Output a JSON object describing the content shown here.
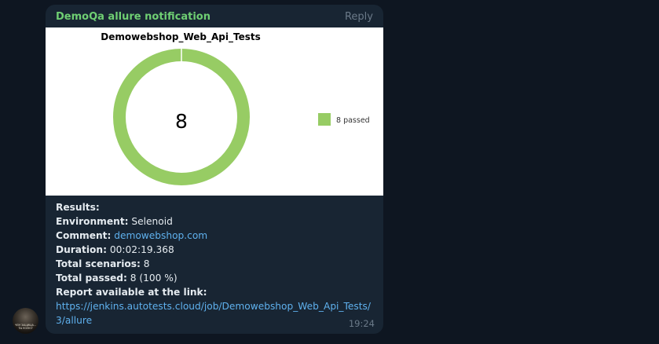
{
  "message": {
    "sender": "DemoQa allure notification",
    "reply_label": "Reply",
    "time": "19:24"
  },
  "avatar": {
    "caption": "ЧЕМ ЗАЩИЩА...\nТЫ КОЛЮ?"
  },
  "chart_data": {
    "type": "pie",
    "title": "Demowebshop_Web_Api_Tests",
    "center_label": "8",
    "slices": [
      {
        "name": "8 passed",
        "value": 8,
        "color": "#97cc64"
      }
    ],
    "legend_position": "right"
  },
  "results": {
    "heading": "Results:",
    "environment_label": "Environment:",
    "environment_value": "Selenoid",
    "comment_label": "Comment:",
    "comment_value": "demowebshop.com",
    "duration_label": "Duration:",
    "duration_value": "00:02:19.368",
    "total_scenarios_label": "Total scenarios:",
    "total_scenarios_value": "8",
    "total_passed_label": "Total passed:",
    "total_passed_value": "8 (100 %)",
    "report_label": "Report available at the link:",
    "report_link_line1": "https://jenkins.autotests.cloud/job/Demowebshop_Web_Api_Tests/",
    "report_link_line2": "3/allure"
  }
}
